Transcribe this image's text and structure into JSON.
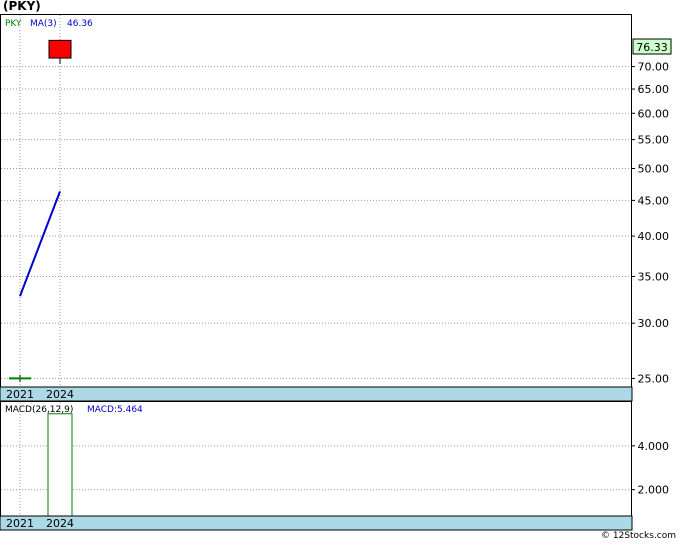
{
  "title": "(PKY)",
  "credit": "© 12Stocks.com",
  "chart_data": [
    {
      "type": "candlestick",
      "ticker_label": "PKY",
      "ma_label": "MA(3)",
      "ma_value": "46.36",
      "last_price": "76.33",
      "scale": "log",
      "ylim": [
        24.3,
        83
      ],
      "yticks": [
        25,
        30,
        35,
        40,
        45,
        50,
        55,
        60,
        65,
        70
      ],
      "ytick_labels": [
        "25.00",
        "30.00",
        "35.00",
        "40.00",
        "45.00",
        "50.00",
        "55.00",
        "60.00",
        "65.00",
        "70.00"
      ],
      "x_labels": [
        "2021",
        "2024"
      ],
      "candles": [
        {
          "period": "2021",
          "open": 25.0,
          "high": 25.3,
          "low": 24.7,
          "close": 25.0,
          "color": "#008000"
        },
        {
          "period": "2024",
          "open": 76.33,
          "high": 76.33,
          "low": 70.6,
          "close": 72.0,
          "color": "#ff0000"
        }
      ],
      "ma_line": {
        "color": "#0000cc",
        "points": [
          {
            "x": "2021",
            "y": 32.8
          },
          {
            "x": "2024",
            "y": 46.36
          }
        ]
      },
      "grid": true,
      "colors": {
        "axis_band": "#add8e6",
        "last_price_box": "#ccffcc"
      }
    },
    {
      "type": "bar",
      "label": "MACD(26,12,9)",
      "value_label": "MACD:5.464",
      "ylim": [
        0.8,
        6.0
      ],
      "yticks": [
        2.0,
        4.0
      ],
      "ytick_labels": [
        "2.000",
        "4.000"
      ],
      "x_labels": [
        "2021",
        "2024"
      ],
      "bars": [
        {
          "period": "2024",
          "value": 5.464,
          "color": "#008000"
        }
      ],
      "grid": true
    }
  ]
}
